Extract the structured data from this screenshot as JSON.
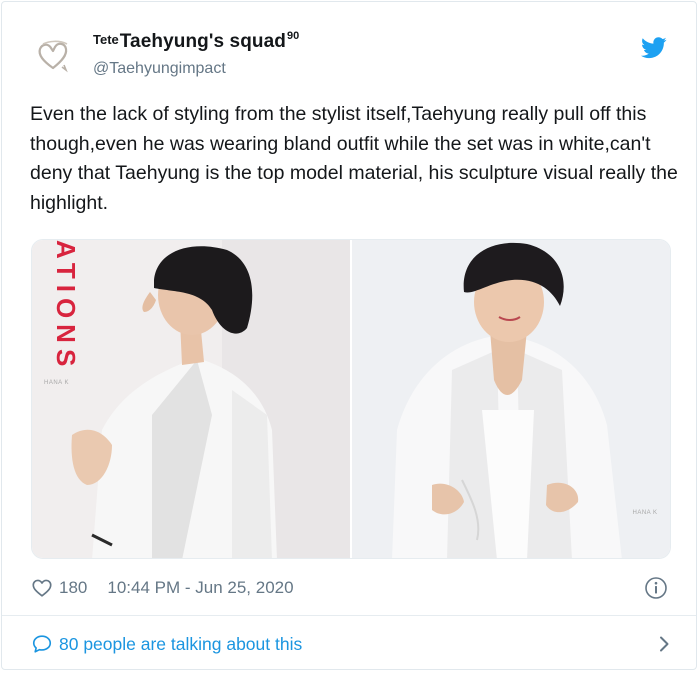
{
  "header": {
    "name_prefix": "Tete",
    "name_main": "Taehyung's squad",
    "name_sup": "90",
    "handle": "@Taehyungimpact"
  },
  "tweet": {
    "text": "Even the lack of styling from the stylist itself,Taehyung really pull off this though,even he was wearing bland outfit while the set was in white,can't deny that Taehyung is the top model material, his sculpture visual really the highlight."
  },
  "media": {
    "left_overlay_text": "ATIONS",
    "left_watermark": "HANA K",
    "right_watermark": "HANA K"
  },
  "meta": {
    "likes": "180",
    "timestamp": "10:44 PM - Jun 25, 2020"
  },
  "footer": {
    "talking_label": "80 people are talking about this"
  },
  "icons": {
    "twitter": "twitter-bird-icon",
    "heart": "heart-icon",
    "info": "info-icon",
    "bubble": "comment-bubble-icon",
    "chevron": "chevron-right-icon"
  },
  "colors": {
    "accent": "#1da1f2",
    "link": "#1b95e0",
    "muted": "#657786",
    "overlay_red": "#d8243e"
  }
}
